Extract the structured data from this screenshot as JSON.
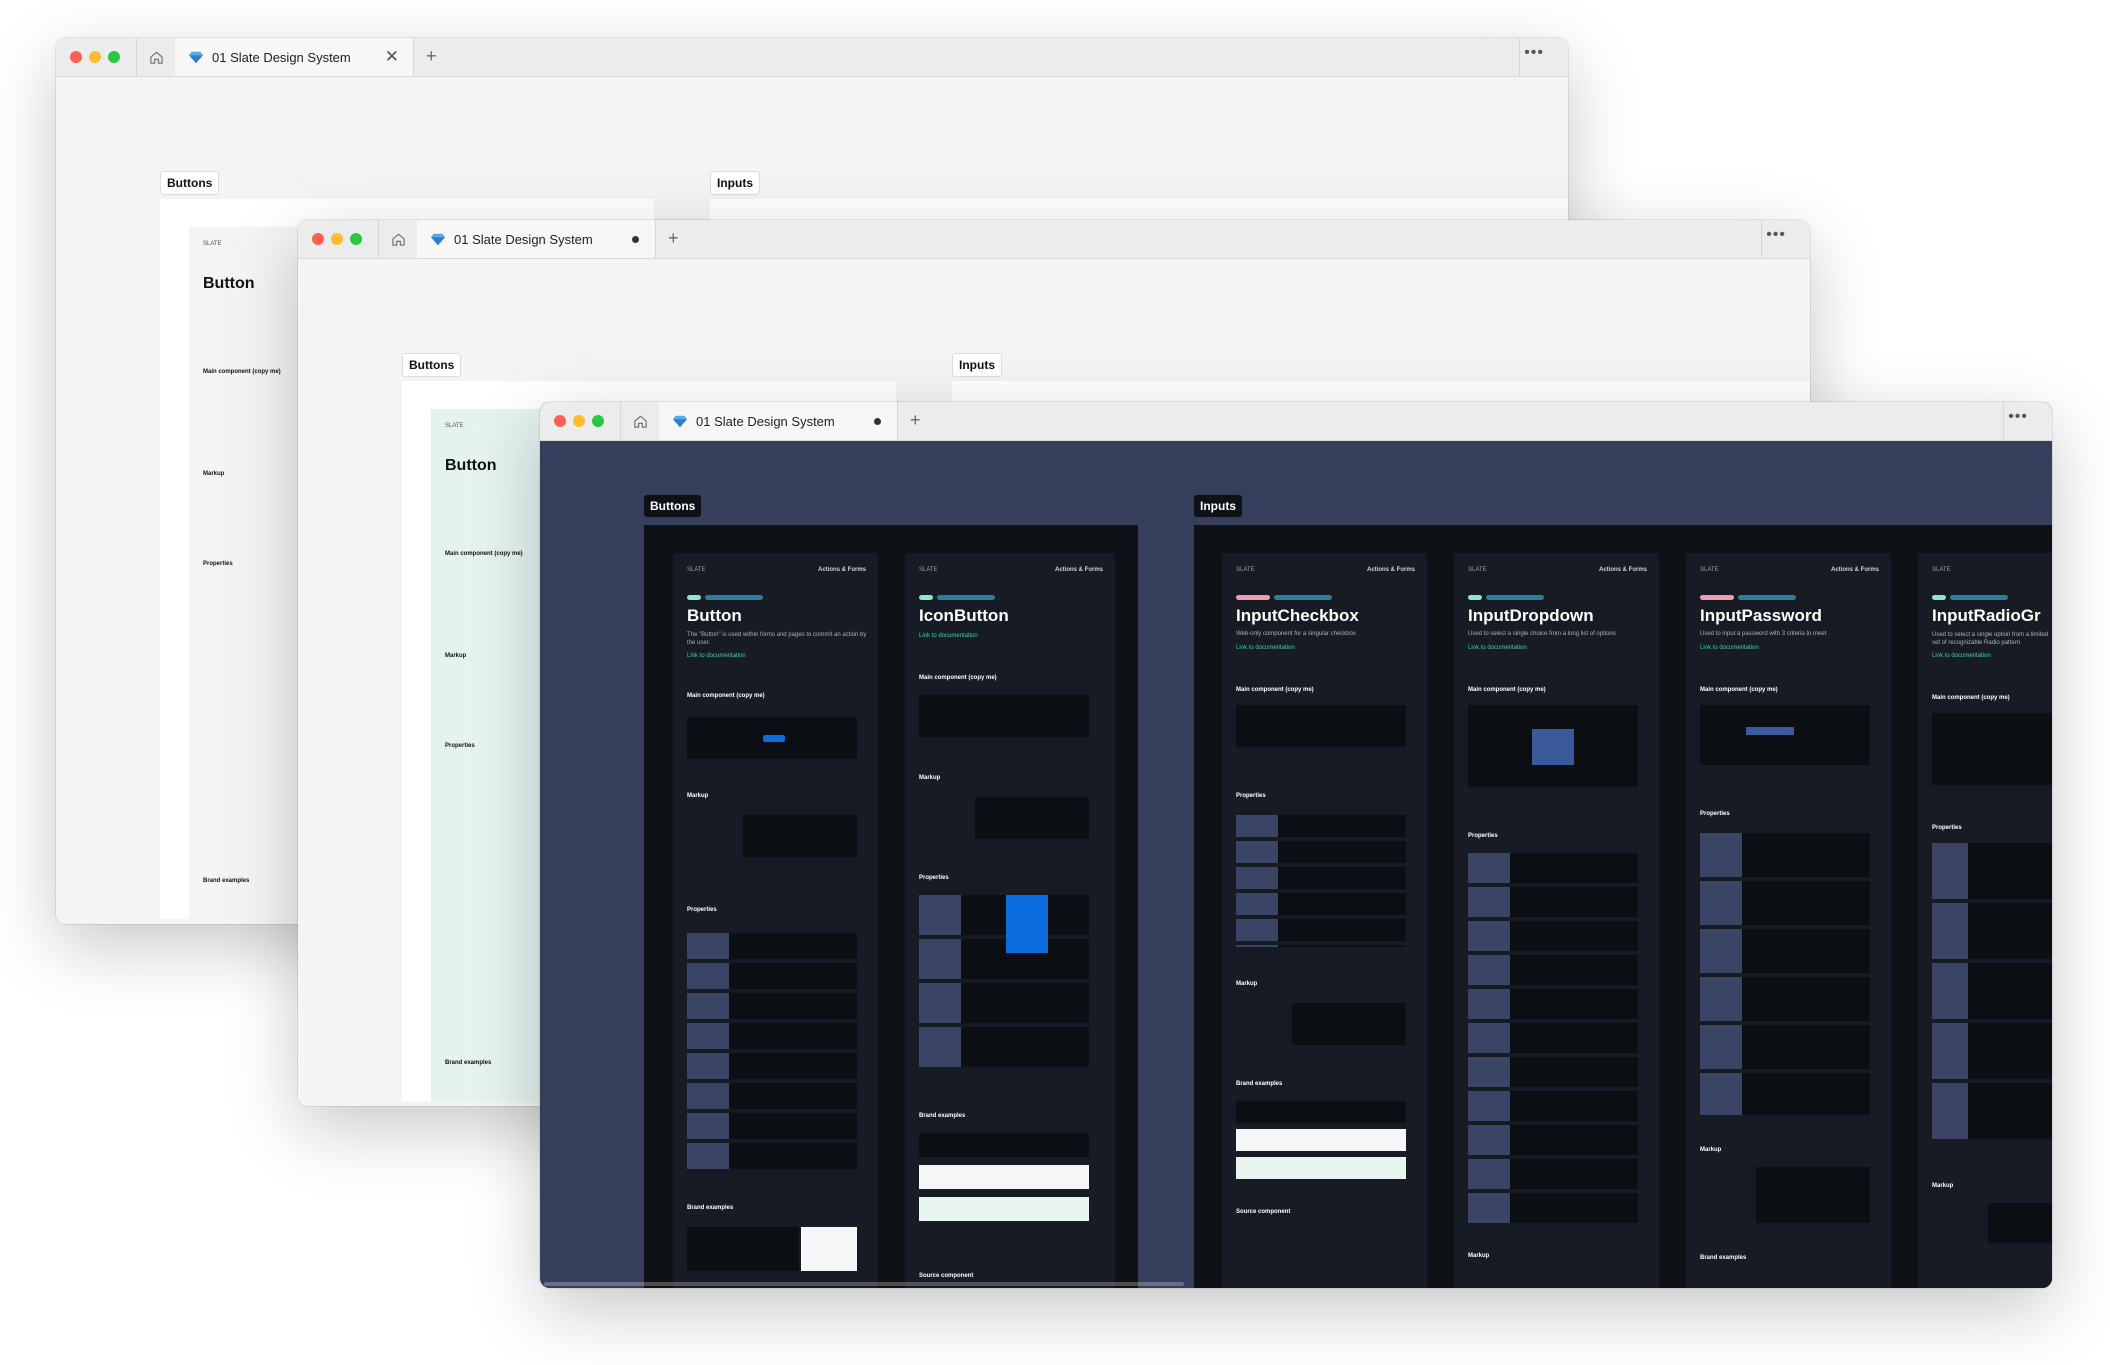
{
  "tab_title": "01 Slate Design System",
  "sections": {
    "buttons": "Buttons",
    "inputs": "Inputs"
  },
  "brand": "SLATE",
  "category": "Actions & Forms",
  "components": {
    "button": {
      "title": "Button",
      "desc": "The \"Button\" is used within forms and pages to commit an action by the user.",
      "link": "Link to documentation"
    },
    "icon_button": {
      "title": "IconButton",
      "link": "Link to documentation"
    },
    "input_checkbox": {
      "title": "InputCheckbox",
      "desc": "Web-only component for a singular checkbox",
      "link": "Link to documentation"
    },
    "input_dropdown": {
      "title": "InputDropdown",
      "desc": "Used to select a single choice from a long list of options",
      "link": "Link to documentation"
    },
    "input_password": {
      "title": "InputPassword",
      "desc": "Used to input a password with 3 criteria to meet",
      "link": "Link to documentation"
    },
    "input_radio_group": {
      "title": "InputRadioGr",
      "desc": "Used to select a single option from a limited set of recognizable Radio pattern",
      "link": "Link to documentation"
    }
  },
  "headings": {
    "main_component": "Main component (copy me)",
    "markup": "Markup",
    "properties": "Properties",
    "brand_examples": "Brand examples",
    "source_component": "Source component"
  },
  "colors": {
    "dark_canvas": "#353f5c",
    "dark_frame": "#0e1116",
    "dark_card": "#161b24",
    "light_canvas": "#f4f4f5",
    "accent_blue": "#0a6cdd",
    "teal": "#2a7e9a",
    "mint": "#8ce6c8",
    "pink": "#ef9ab0"
  }
}
